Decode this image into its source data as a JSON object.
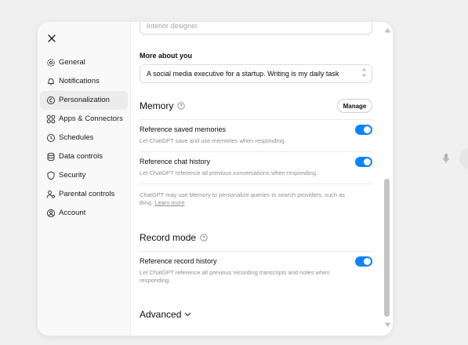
{
  "sidebar": {
    "close_icon": "close-icon",
    "items": [
      {
        "label": "General",
        "icon": "gear-icon"
      },
      {
        "label": "Notifications",
        "icon": "bell-icon"
      },
      {
        "label": "Personalization",
        "icon": "personalization-icon",
        "active": true
      },
      {
        "label": "Apps & Connectors",
        "icon": "apps-icon"
      },
      {
        "label": "Schedules",
        "icon": "clock-icon"
      },
      {
        "label": "Data controls",
        "icon": "data-icon"
      },
      {
        "label": "Security",
        "icon": "shield-icon"
      },
      {
        "label": "Parental controls",
        "icon": "parental-icon"
      },
      {
        "label": "Account",
        "icon": "account-icon"
      }
    ]
  },
  "occupation": {
    "placeholder": "Interior designer"
  },
  "more_about": {
    "label": "More about you",
    "value": "A social media executive for a startup. Writing is my daily task"
  },
  "memory": {
    "title": "Memory",
    "manage_label": "Manage",
    "saved": {
      "title": "Reference saved memories",
      "desc": "Let ChatGPT save and use memories when responding.",
      "enabled": true
    },
    "chat": {
      "title": "Reference chat history",
      "desc": "Let ChatGPT reference all previous conversations when responding.",
      "enabled": true
    },
    "note": "ChatGPT may use Memory to personalize queries to search providers, such as Bing.",
    "learn_more": "Learn more"
  },
  "record": {
    "title": "Record mode",
    "history": {
      "title": "Reference record history",
      "desc": "Let ChatGPT reference all previous recording transcripts and notes when responding.",
      "enabled": true
    }
  },
  "advanced_label": "Advanced",
  "colors": {
    "accent": "#0d84ff",
    "sidebar_bg": "#f9f9f9",
    "active_bg": "#ececec"
  }
}
